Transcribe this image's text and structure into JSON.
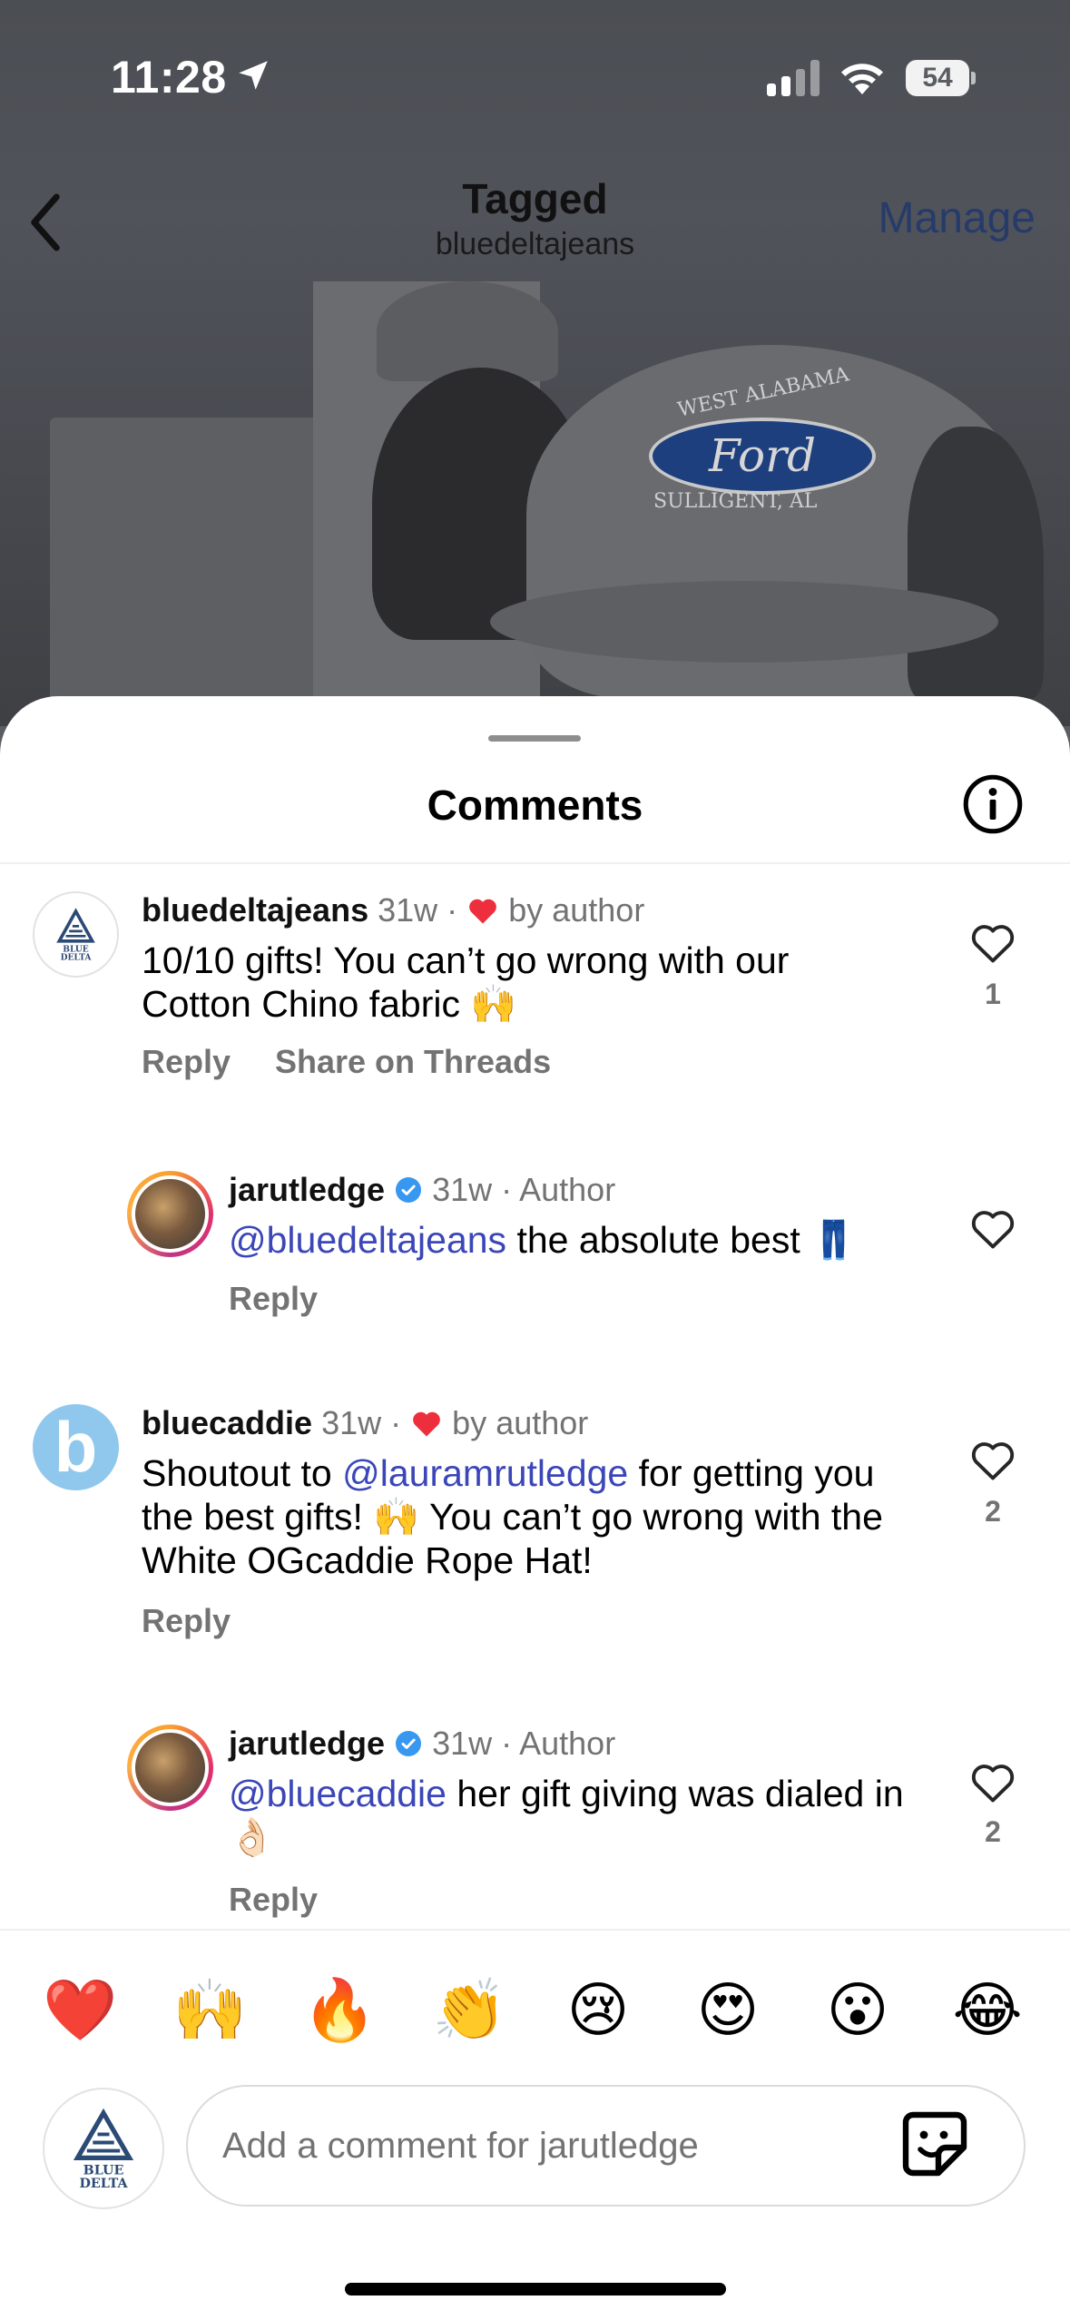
{
  "status_bar": {
    "time": "11:28",
    "battery": "54"
  },
  "nav": {
    "title": "Tagged",
    "subtitle": "bluedeltajeans",
    "action": "Manage"
  },
  "sheet": {
    "title": "Comments"
  },
  "comments": [
    {
      "username": "bluedeltajeans",
      "meta": "31w",
      "liked_by_author": "by author",
      "text": "10/10 gifts! You can’t go wrong with our Cotton Chino fabric 🙌",
      "reply": "Reply",
      "share": "Share on Threads",
      "likes": "1"
    },
    {
      "username": "jarutledge",
      "meta": "31w · Author",
      "mention": "@bluedeltajeans",
      "text": " the absolute best 👖",
      "reply": "Reply"
    },
    {
      "username": "bluecaddie",
      "meta": "31w",
      "liked_by_author": "by author",
      "text_pre": "Shoutout to ",
      "mention": "@lauramrutledge",
      "text_post": " for getting you the best gifts! 🙌 You can’t go wrong with the White OGcaddie Rope Hat!",
      "reply": "Reply",
      "likes": "2",
      "avatar_letter": "b"
    },
    {
      "username": "jarutledge",
      "meta": "31w · Author",
      "mention": "@bluecaddie",
      "text": " her gift giving was dialed in 👌🏻",
      "reply": "Reply",
      "likes": "2"
    }
  ],
  "reactions": [
    "❤️",
    "🙌",
    "🔥",
    "👏",
    "😢",
    "😍",
    "😮",
    "😂"
  ],
  "composer": {
    "placeholder": "Add a comment for jarutledge"
  },
  "brand_logo_text": "BLUE DELTA",
  "colors": {
    "mention": "#3b46b8",
    "heart": "#ed2f3d",
    "verified": "#3897f0"
  }
}
